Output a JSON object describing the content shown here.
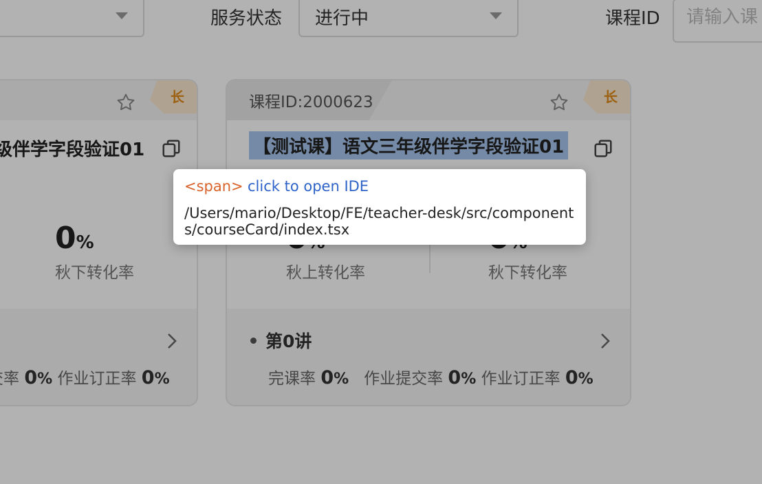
{
  "filters": {
    "service_status_label": "服务状态",
    "service_status_value": "进行中",
    "course_id_label": "课程ID",
    "course_id_placeholder": "请输入课"
  },
  "left_card": {
    "corner_badge": "长",
    "title_partial": "级伴学字段验证01",
    "stat_value": "0",
    "stat_unit": "%",
    "stat_label": "秋下转化率",
    "rates": [
      {
        "label": "交率",
        "value": "0",
        "unit": "%"
      },
      {
        "label": "作业订正率",
        "value": "0",
        "unit": "%"
      }
    ]
  },
  "main_card": {
    "course_id": "课程ID:2000623",
    "corner_badge": "长",
    "title": "【测试课】语文三年级伴学字段验证01",
    "stats": [
      {
        "value": "0",
        "unit": "%",
        "label": "秋上转化率"
      },
      {
        "value": "0",
        "unit": "%",
        "label": "秋下转化率"
      }
    ],
    "lesson": "第0讲",
    "rates": [
      {
        "label": "完课率",
        "value": "0",
        "unit": "%"
      },
      {
        "label": "作业提交率",
        "value": "0",
        "unit": "%"
      },
      {
        "label": "作业订正率",
        "value": "0",
        "unit": "%"
      }
    ]
  },
  "tooltip": {
    "tag": "<span>",
    "action": "click to open IDE",
    "path": "/Users/mario/Desktop/FE/teacher-desk/src/components/courseCard/index.tsx"
  },
  "icons": {
    "favorite": "star-outline-icon",
    "copy": "copy-icon",
    "chevron": "chevron-right-icon",
    "dropdown": "caret-down-icon"
  },
  "colors": {
    "badge_text": "#e08a17",
    "badge_bg": "#fbe8cf",
    "highlight": "#a8c6f0",
    "tooltip_tag": "#d8622a",
    "tooltip_action": "#2d63c8"
  }
}
